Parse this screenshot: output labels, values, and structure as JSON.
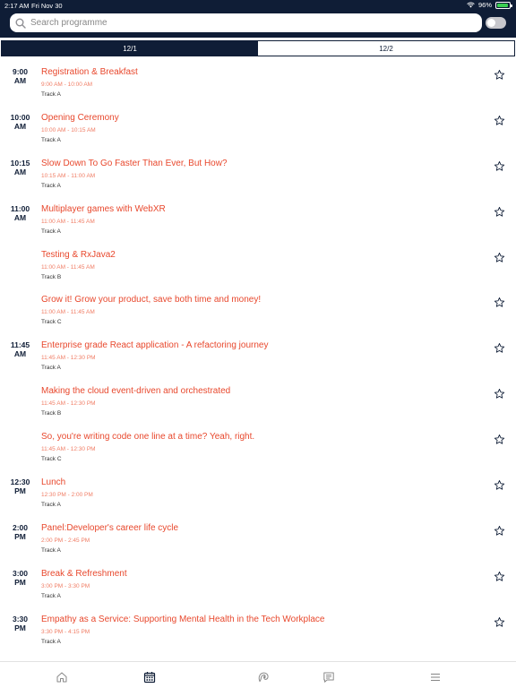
{
  "status_bar": {
    "time": "2:17 AM",
    "date": "Fri Nov 30",
    "battery": "96%",
    "battery_level": 0.96,
    "wifi_icon": "wifi-icon",
    "battery_icon": "battery-icon"
  },
  "search": {
    "placeholder": "Search programme",
    "value": "",
    "icon": "search-icon"
  },
  "toggle": {
    "on": false
  },
  "tabs": [
    {
      "label": "12/1",
      "active": true
    },
    {
      "label": "12/2",
      "active": false
    }
  ],
  "sessions": [
    {
      "time": "9:00 AM",
      "time_line1": "9:00",
      "time_line2": "AM",
      "title": "Registration & Breakfast",
      "range": "9:00 AM - 10:00 AM",
      "track": "Track A"
    },
    {
      "time": "10:00 AM",
      "time_line1": "10:00",
      "time_line2": "AM",
      "title": "Opening Ceremony",
      "range": "10:00 AM - 10:15 AM",
      "track": "Track A"
    },
    {
      "time": "10:15 AM",
      "time_line1": "10:15",
      "time_line2": "AM",
      "title": "Slow Down To Go Faster Than Ever, But How?",
      "range": "10:15 AM - 11:00 AM",
      "track": "Track A"
    },
    {
      "time": "11:00 AM",
      "time_line1": "11:00",
      "time_line2": "AM",
      "title": "Multiplayer games with WebXR",
      "range": "11:00 AM - 11:45 AM",
      "track": "Track A"
    },
    {
      "time": "",
      "time_line1": "",
      "time_line2": "",
      "title": "Testing & RxJava2",
      "range": "11:00 AM - 11:45 AM",
      "track": "Track B"
    },
    {
      "time": "",
      "time_line1": "",
      "time_line2": "",
      "title": "Grow it! Grow your product, save both time and money!",
      "range": "11:00 AM - 11:45 AM",
      "track": "Track C"
    },
    {
      "time": "11:45 AM",
      "time_line1": "11:45",
      "time_line2": "AM",
      "title": "Enterprise grade React application - A refactoring journey",
      "range": "11:45 AM - 12:30 PM",
      "track": "Track A"
    },
    {
      "time": "",
      "time_line1": "",
      "time_line2": "",
      "title": "Making the cloud event-driven and orchestrated",
      "range": "11:45 AM - 12:30 PM",
      "track": "Track B"
    },
    {
      "time": "",
      "time_line1": "",
      "time_line2": "",
      "title": "So, you're writing code one line at a time? Yeah, right.",
      "range": "11:45 AM - 12:30 PM",
      "track": "Track C"
    },
    {
      "time": "12:30 PM",
      "time_line1": "12:30",
      "time_line2": "PM",
      "title": "Lunch",
      "range": "12:30 PM - 2:00 PM",
      "track": "Track A"
    },
    {
      "time": "2:00 PM",
      "time_line1": "2:00",
      "time_line2": "PM",
      "title": "Panel:Developer's career life cycle",
      "range": "2:00 PM - 2:45 PM",
      "track": "Track A"
    },
    {
      "time": "3:00 PM",
      "time_line1": "3:00",
      "time_line2": "PM",
      "title": "Break & Refreshment",
      "range": "3:00 PM - 3:30 PM",
      "track": "Track A"
    },
    {
      "time": "3:30 PM",
      "time_line1": "3:30",
      "time_line2": "PM",
      "title": "Empathy as a Service: Supporting Mental Health in the Tech Workplace",
      "range": "3:30 PM - 4:15 PM",
      "track": "Track A"
    }
  ],
  "bottom_nav": [
    {
      "icon": "home-icon",
      "active": false
    },
    {
      "icon": "calendar-icon",
      "active": true
    },
    {
      "icon": "speakers-icon",
      "active": false
    },
    {
      "icon": "chat-icon",
      "active": false
    },
    {
      "icon": "menu-icon",
      "active": false
    }
  ],
  "colors": {
    "header_bg": "#0f1d36",
    "title_red": "#e8482d",
    "range_red": "#f07d65",
    "nav_icon": "#8a8a8a",
    "nav_active": "#0f1d36"
  }
}
